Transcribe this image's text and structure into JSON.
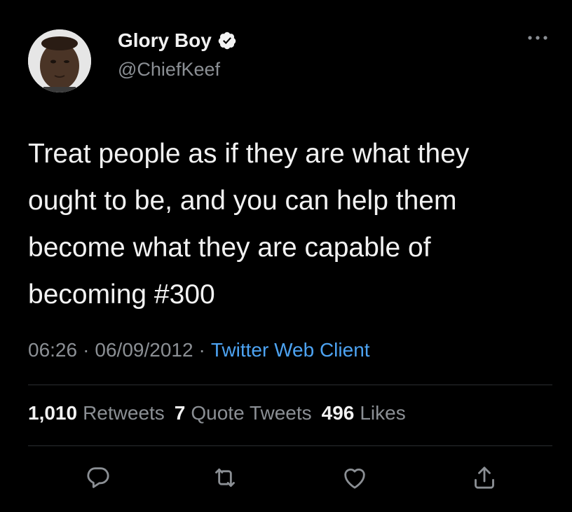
{
  "author": {
    "name": "Glory Boy",
    "handle": "@ChiefKeef",
    "verified": true,
    "avatar_icon": "avatar-photo"
  },
  "tweet": {
    "text": "Treat people as if they are what they\nought to be, and you can help them\nbecome what they are capable of\nbecoming #300"
  },
  "meta": {
    "time": "06:26",
    "separator": "·",
    "date": "06/09/2012",
    "client": "Twitter Web Client"
  },
  "stats": {
    "retweets": {
      "count": "1,010",
      "label": "Retweets"
    },
    "quotes": {
      "count": "7",
      "label": "Quote Tweets"
    },
    "likes": {
      "count": "496",
      "label": "Likes"
    }
  },
  "actions": [
    "reply-icon",
    "retweet-icon",
    "like-icon",
    "share-icon"
  ],
  "colors": {
    "background": "#000000",
    "text": "#f2f2f2",
    "secondary": "#8b8f94",
    "link": "#4da3f2",
    "divider": "#2b2e31"
  }
}
